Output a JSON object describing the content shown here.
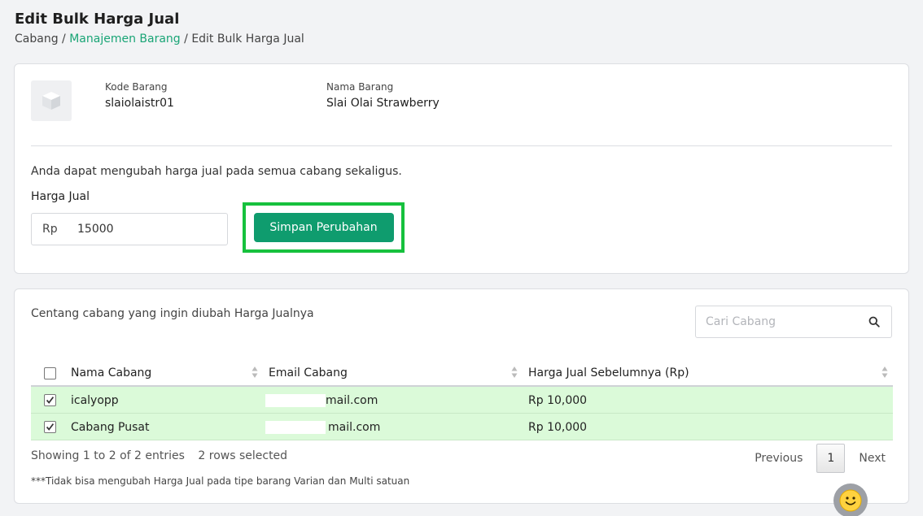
{
  "header": {
    "title": "Edit Bulk Harga Jual",
    "breadcrumb": {
      "root": "Cabang",
      "sep1": " / ",
      "link": "Manajemen Barang",
      "sep2": " / ",
      "current": "Edit Bulk Harga Jual"
    }
  },
  "product": {
    "code_label": "Kode Barang",
    "code_value": "slaiolaistr01",
    "name_label": "Nama Barang",
    "name_value": "Slai Olai Strawberry"
  },
  "bulk_edit": {
    "info": "Anda dapat mengubah harga jual pada semua cabang sekaligus.",
    "price_label": "Harga Jual",
    "currency_prefix": "Rp",
    "price_value": "15000",
    "save_label": "Simpan Perubahan"
  },
  "branches": {
    "hint": "Centang cabang yang ingin diubah Harga Jualnya",
    "search_placeholder": "Cari Cabang",
    "columns": [
      "Nama Cabang",
      "Email Cabang",
      "Harga Jual Sebelumnya (Rp)"
    ],
    "rows": [
      {
        "name": "icalyopp",
        "email": "mail.com",
        "price": "Rp 10,000",
        "checked": true
      },
      {
        "name": "Cabang Pusat",
        "email": "mail.com",
        "price": "Rp 10,000",
        "checked": true
      }
    ],
    "showing": "Showing 1 to 2 of 2 entries",
    "selected": "2 rows selected",
    "pagination": {
      "prev": "Previous",
      "page": "1",
      "next": "Next"
    },
    "footnote": "***Tidak bisa mengubah Harga Jual pada tipe barang Varian dan Multi satuan"
  },
  "colors": {
    "accent": "#1aa576",
    "primary_button": "#0f9c6e",
    "selected_row": "#dbfad9",
    "highlight_border": "#16c13d"
  }
}
